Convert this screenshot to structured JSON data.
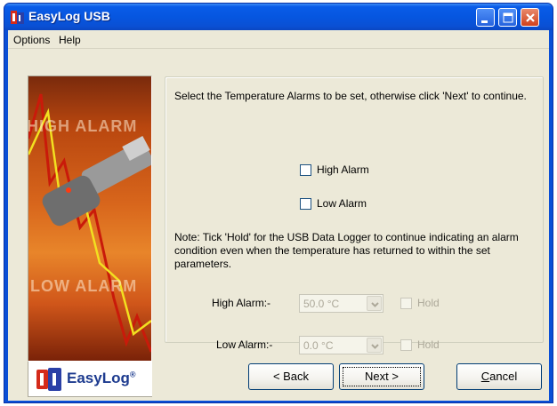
{
  "window": {
    "title": "EasyLog USB"
  },
  "menu": {
    "options": "Options",
    "help": "Help"
  },
  "banner": {
    "high_text": "HIGH ALARM",
    "low_text": "LOW ALARM",
    "logo_text": "EasyLog",
    "logo_mark": "®"
  },
  "content": {
    "intro": "Select the Temperature Alarms to be set, otherwise click 'Next' to continue.",
    "high_alarm_checkbox": "High Alarm",
    "low_alarm_checkbox": "Low Alarm",
    "note": "Note: Tick 'Hold' for the USB Data Logger to continue indicating an alarm condition even when the temperature has returned to within the set parameters.",
    "high_alarm_label": "High Alarm:-",
    "high_alarm_value": "50.0 °C",
    "low_alarm_label": "Low Alarm:-",
    "low_alarm_value": "0.0 °C",
    "hold_label": "Hold"
  },
  "buttons": {
    "back": "< Back",
    "next": "Next >",
    "cancel_prefix": "",
    "cancel_underlined": "C",
    "cancel_rest": "ancel"
  }
}
